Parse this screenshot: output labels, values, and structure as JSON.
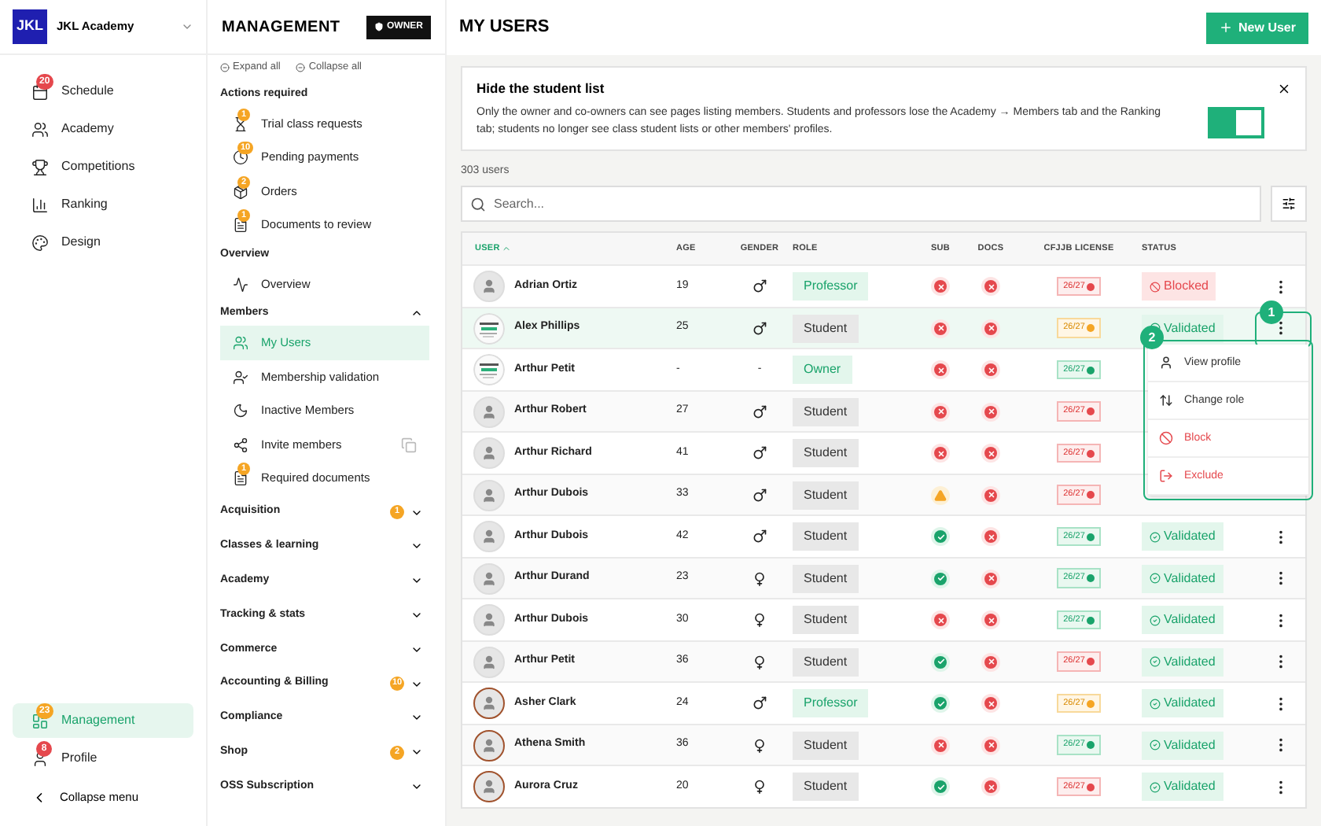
{
  "academy": {
    "logo": "JKL",
    "name": "JKL Academy"
  },
  "main_nav": [
    {
      "label": "Schedule",
      "badge": "20",
      "color": "#e5484d",
      "selected": false
    },
    {
      "label": "Academy",
      "selected": false
    },
    {
      "label": "Competitions",
      "selected": false
    },
    {
      "label": "Ranking",
      "selected": false
    },
    {
      "label": "Design",
      "selected": false
    }
  ],
  "bottom_nav": [
    {
      "label": "Management",
      "badge": "23",
      "color": "#f5a524",
      "selected": true
    },
    {
      "label": "Profile",
      "badge": "8",
      "color": "#e5484d",
      "selected": false
    }
  ],
  "collapse_menu": "Collapse menu",
  "management": {
    "title": "MANAGEMENT",
    "role_badge": "OWNER",
    "expand_all": "Expand all",
    "collapse_all": "Collapse all",
    "sections": [
      {
        "title": "Actions required",
        "items": [
          {
            "label": "Trial class requests",
            "badge": "1",
            "selected": false
          },
          {
            "label": "Pending payments",
            "badge": "10",
            "selected": false
          },
          {
            "label": "Orders",
            "badge": "2",
            "selected": false
          },
          {
            "label": "Documents to review",
            "badge": "1",
            "selected": false
          }
        ]
      },
      {
        "title": "Overview",
        "items": [
          {
            "label": "Overview",
            "selected": false
          }
        ]
      },
      {
        "title": "Members",
        "expanded": true,
        "items": [
          {
            "label": "My Users",
            "selected": true
          },
          {
            "label": "Membership validation",
            "selected": false
          },
          {
            "label": "Inactive Members",
            "selected": false
          },
          {
            "label": "Invite members",
            "copy": true,
            "selected": false
          },
          {
            "label": "Required documents",
            "badge": "1",
            "selected": false
          }
        ]
      },
      {
        "title": "Acquisition",
        "expanded": false,
        "badge": "1"
      },
      {
        "title": "Classes & learning",
        "expanded": false
      },
      {
        "title": "Academy",
        "expanded": false
      },
      {
        "title": "Tracking & stats",
        "expanded": false
      },
      {
        "title": "Commerce",
        "expanded": false
      },
      {
        "title": "Accounting & Billing",
        "expanded": false,
        "badge": "10"
      },
      {
        "title": "Compliance",
        "expanded": false
      },
      {
        "title": "Shop",
        "expanded": false,
        "badge": "2"
      },
      {
        "title": "OSS Subscription",
        "expanded": false
      }
    ]
  },
  "page": {
    "title": "MY USERS",
    "new_button": "New User"
  },
  "banner": {
    "title": "Hide the student list",
    "text": "Only the owner and co-owners can see pages listing members. Students and professors lose the Academy → Members tab and the Ranking tab; students no longer see class student lists or other members' profiles.",
    "on": true
  },
  "user_count": "303 users",
  "search": {
    "placeholder": "Search..."
  },
  "table": {
    "columns": [
      "USER",
      "AGE",
      "GENDER",
      "ROLE",
      "SUB",
      "DOCS",
      "CFJJB LICENSE",
      "STATUS"
    ],
    "rows": [
      {
        "avatar": {
          "kind": "plain"
        },
        "name": "Adrian Ortiz",
        "age": "19",
        "gender": {
          "kind": "male"
        },
        "role": {
          "text": "Professor",
          "kind": "professor"
        },
        "sub": {
          "kind": "cross"
        },
        "docs": {
          "kind": "cross"
        },
        "license": {
          "text": "26/27",
          "kind": "bad"
        },
        "status": {
          "text": "Blocked",
          "kind": "blocked"
        },
        "selected": false
      },
      {
        "name": "Alex Phillips",
        "age": "25",
        "gender": {
          "kind": "male"
        },
        "role": {
          "text": "Student",
          "kind": "student"
        },
        "sub": {
          "kind": "cross"
        },
        "docs": {
          "kind": "cross"
        },
        "license": {
          "text": "26/27",
          "kind": "warn"
        },
        "status": {
          "text": "Validated",
          "kind": "validated"
        },
        "selected": true
      },
      {
        "name": "Arthur Petit",
        "age": "-",
        "gender": {
          "text": "-"
        },
        "role": {
          "text": "Owner",
          "kind": "owner"
        },
        "sub": {
          "kind": "cross"
        },
        "docs": {
          "kind": "cross"
        },
        "license": {
          "text": "26/27",
          "kind": "ok"
        },
        "selected": false
      },
      {
        "avatar": {
          "kind": "plain"
        },
        "name": "Arthur Robert",
        "age": "27",
        "gender": {
          "kind": "male"
        },
        "role": {
          "text": "Student",
          "kind": "student"
        },
        "sub": {
          "kind": "cross"
        },
        "docs": {
          "kind": "cross"
        },
        "license": {
          "text": "26/27",
          "kind": "bad"
        },
        "selected": false
      },
      {
        "avatar": {
          "kind": "plain"
        },
        "name": "Arthur Richard",
        "age": "41",
        "gender": {
          "kind": "male"
        },
        "role": {
          "text": "Student",
          "kind": "student"
        },
        "sub": {
          "kind": "cross"
        },
        "docs": {
          "kind": "cross"
        },
        "license": {
          "text": "26/27",
          "kind": "bad"
        },
        "selected": false
      },
      {
        "avatar": {
          "kind": "plain"
        },
        "name": "Arthur Dubois",
        "age": "33",
        "gender": {
          "kind": "male"
        },
        "role": {
          "text": "Student",
          "kind": "student"
        },
        "sub": {
          "kind": "warning"
        },
        "docs": {
          "kind": "cross"
        },
        "license": {
          "text": "26/27",
          "kind": "bad"
        },
        "selected": false
      },
      {
        "avatar": {
          "kind": "plain"
        },
        "name": "Arthur Dubois",
        "age": "42",
        "gender": {
          "kind": "male"
        },
        "role": {
          "text": "Student",
          "kind": "student"
        },
        "sub": {
          "kind": "check"
        },
        "docs": {
          "kind": "cross"
        },
        "license": {
          "text": "26/27",
          "kind": "ok"
        },
        "status": {
          "text": "Validated",
          "kind": "validated"
        },
        "selected": false
      },
      {
        "avatar": {
          "kind": "plain"
        },
        "name": "Arthur Durand",
        "age": "23",
        "gender": {
          "kind": "female"
        },
        "role": {
          "text": "Student",
          "kind": "student"
        },
        "sub": {
          "kind": "check"
        },
        "docs": {
          "kind": "cross"
        },
        "license": {
          "text": "26/27",
          "kind": "ok"
        },
        "status": {
          "text": "Validated",
          "kind": "validated"
        },
        "selected": false
      },
      {
        "avatar": {
          "kind": "plain"
        },
        "name": "Arthur Dubois",
        "age": "30",
        "gender": {
          "kind": "female"
        },
        "role": {
          "text": "Student",
          "kind": "student"
        },
        "sub": {
          "kind": "cross"
        },
        "docs": {
          "kind": "cross"
        },
        "license": {
          "text": "26/27",
          "kind": "ok"
        },
        "status": {
          "text": "Validated",
          "kind": "validated"
        },
        "selected": false
      },
      {
        "avatar": {
          "kind": "plain"
        },
        "name": "Arthur Petit",
        "age": "36",
        "gender": {
          "kind": "female"
        },
        "role": {
          "text": "Student",
          "kind": "student"
        },
        "sub": {
          "kind": "check"
        },
        "docs": {
          "kind": "cross"
        },
        "license": {
          "text": "26/27",
          "kind": "bad"
        },
        "status": {
          "text": "Validated",
          "kind": "validated"
        },
        "selected": false
      },
      {
        "avatar": {
          "kind": "ring"
        },
        "name": "Asher Clark",
        "age": "24",
        "gender": {
          "kind": "male"
        },
        "role": {
          "text": "Professor",
          "kind": "professor"
        },
        "sub": {
          "kind": "check"
        },
        "docs": {
          "kind": "cross"
        },
        "license": {
          "text": "26/27",
          "kind": "warn"
        },
        "status": {
          "text": "Validated",
          "kind": "validated"
        },
        "selected": false
      },
      {
        "avatar": {
          "kind": "ring"
        },
        "name": "Athena Smith",
        "age": "36",
        "gender": {
          "kind": "female"
        },
        "role": {
          "text": "Student",
          "kind": "student"
        },
        "sub": {
          "kind": "cross"
        },
        "docs": {
          "kind": "cross"
        },
        "license": {
          "text": "26/27",
          "kind": "ok"
        },
        "status": {
          "text": "Validated",
          "kind": "validated"
        },
        "selected": false
      },
      {
        "avatar": {
          "kind": "ring"
        },
        "name": "Aurora Cruz",
        "age": "20",
        "gender": {
          "kind": "female"
        },
        "role": {
          "text": "Student",
          "kind": "student"
        },
        "sub": {
          "kind": "check"
        },
        "docs": {
          "kind": "cross"
        },
        "license": {
          "text": "26/27",
          "kind": "bad"
        },
        "status": {
          "text": "Validated",
          "kind": "validated"
        },
        "selected": false
      }
    ]
  },
  "row_menu": {
    "items": [
      {
        "label": "View profile",
        "kind": "normal"
      },
      {
        "label": "Change role",
        "kind": "normal"
      },
      {
        "label": "Block",
        "kind": "danger"
      },
      {
        "label": "Exclude",
        "kind": "danger"
      }
    ]
  },
  "callouts": [
    "1",
    "2"
  ]
}
